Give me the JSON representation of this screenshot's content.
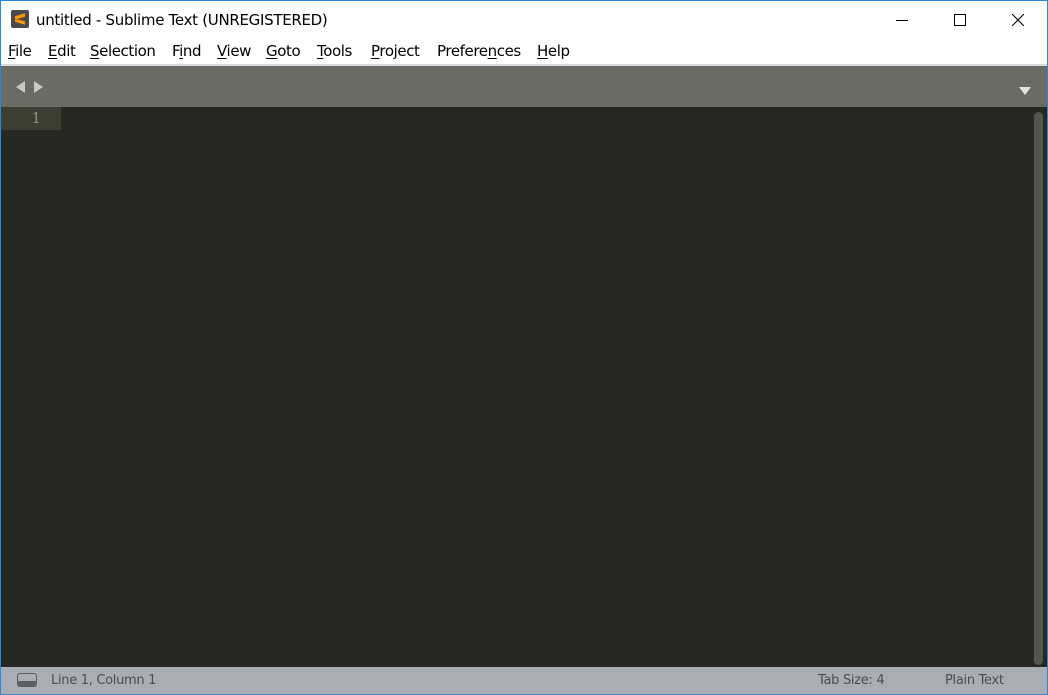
{
  "window": {
    "title": "untitled - Sublime Text (UNREGISTERED)",
    "app_icon": "sublime-text-logo",
    "controls": {
      "minimize": "minimize-icon",
      "maximize": "maximize-icon",
      "close": "close-icon"
    }
  },
  "menubar": {
    "items": [
      {
        "label": "File",
        "mnemonic_index": 0
      },
      {
        "label": "Edit",
        "mnemonic_index": 0
      },
      {
        "label": "Selection",
        "mnemonic_index": 0
      },
      {
        "label": "Find",
        "mnemonic_index": 1
      },
      {
        "label": "View",
        "mnemonic_index": 0
      },
      {
        "label": "Goto",
        "mnemonic_index": 0
      },
      {
        "label": "Tools",
        "mnemonic_index": 0
      },
      {
        "label": "Project",
        "mnemonic_index": 0
      },
      {
        "label": "Preferences",
        "mnemonic_index": 7
      },
      {
        "label": "Help",
        "mnemonic_index": 0
      }
    ]
  },
  "tabbar": {
    "nav_left_icon": "triangle-left-icon",
    "nav_right_icon": "triangle-right-icon",
    "dropdown_icon": "triangle-down-icon"
  },
  "editor": {
    "line_numbers": [
      "1"
    ],
    "content": ""
  },
  "statusbar": {
    "panel_icon": "panel-toggle-icon",
    "position": "Line 1, Column 1",
    "tab_size": "Tab Size: 4",
    "syntax": "Plain Text"
  },
  "colors": {
    "accent_border": "#2b88d8",
    "tabbar_bg": "#6b6b63",
    "editor_bg": "#272822",
    "gutter_highlight": "#3e3d32",
    "statusbar_bg": "#a8adb6",
    "logo_orange": "#ff9800"
  }
}
